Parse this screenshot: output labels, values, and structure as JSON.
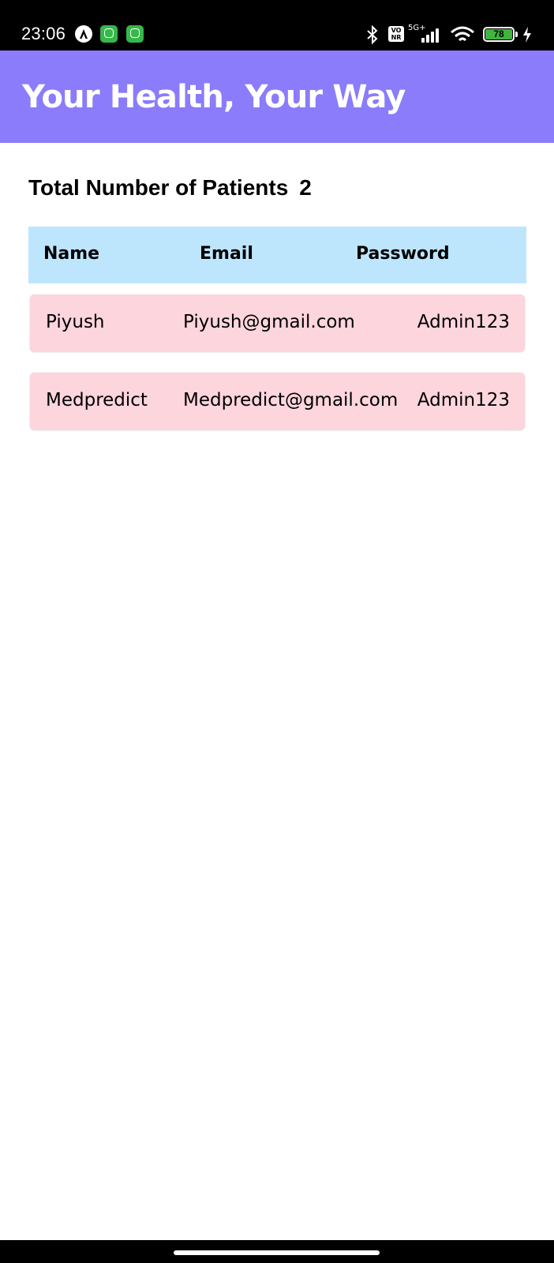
{
  "status_bar": {
    "time": "23:06",
    "network": "5G+",
    "volte": "VO\nNR",
    "battery": "78",
    "icons": [
      "android-icon",
      "app-icon",
      "app-icon",
      "bluetooth-icon",
      "volte-icon",
      "signal-icon",
      "wifi-icon",
      "battery-icon",
      "charging-icon"
    ]
  },
  "app_bar": {
    "title": "Your Health, Your Way",
    "color": "#8a7cfb"
  },
  "summary": {
    "label": "Total Number of Patients",
    "count": "2"
  },
  "table": {
    "headers": [
      "Name",
      "Email",
      "Password"
    ],
    "header_color": "#bde6fd",
    "row_color": "#fdd5dd",
    "rows": [
      {
        "name": "Piyush",
        "email": "Piyush@gmail.com",
        "password": "Admin123"
      },
      {
        "name": "Medpredict",
        "email": "Medpredict@gmail.com",
        "password": "Admin123"
      }
    ]
  }
}
